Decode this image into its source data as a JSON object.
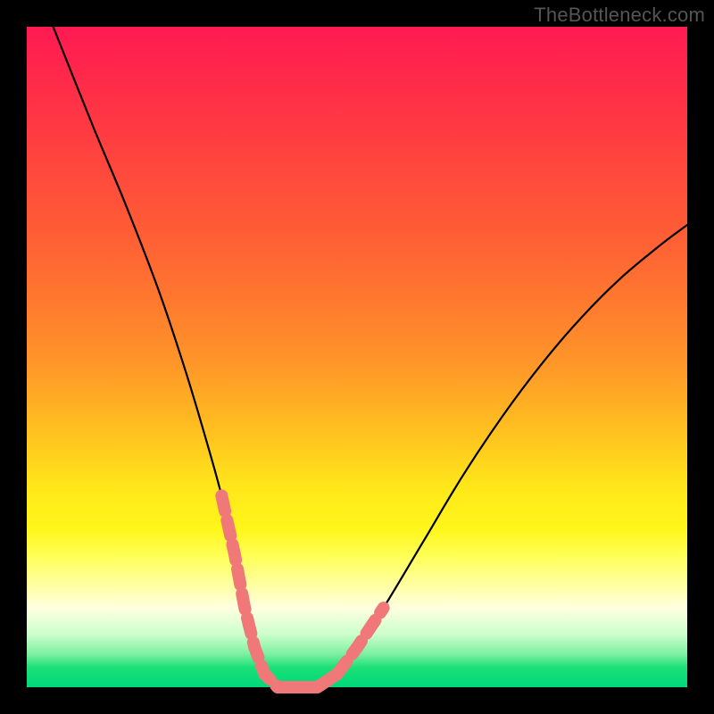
{
  "watermark": "TheBottleneck.com",
  "chart_data": {
    "type": "line",
    "title": "",
    "xlabel": "",
    "ylabel": "",
    "xlim": [
      0,
      100
    ],
    "ylim": [
      0,
      100
    ],
    "legend": false,
    "grid": false,
    "background_gradient": {
      "direction": "vertical",
      "stops": [
        {
          "pos": 0,
          "color": "#ff1a52"
        },
        {
          "pos": 30,
          "color": "#ff5a36"
        },
        {
          "pos": 62,
          "color": "#ffc41f"
        },
        {
          "pos": 80,
          "color": "#ffff55"
        },
        {
          "pos": 92,
          "color": "#ccffcc"
        },
        {
          "pos": 100,
          "color": "#00d87a"
        }
      ]
    },
    "series": [
      {
        "name": "bottleneck-curve",
        "color": "#000000",
        "x": [
          4,
          10,
          15,
          20,
          24,
          27,
          29.5,
          31.5,
          33,
          34.5,
          36,
          38,
          41,
          44,
          47,
          50,
          54,
          60,
          66,
          72,
          78,
          84,
          90,
          96,
          100
        ],
        "y": [
          100,
          85,
          73,
          60,
          48,
          38,
          29,
          20,
          12,
          6,
          2,
          0,
          0,
          0,
          2,
          6,
          12,
          22,
          32,
          41,
          49,
          56,
          62,
          67,
          70
        ]
      }
    ],
    "highlight_segments": [
      {
        "name": "left-threshold-band",
        "color": "#f07878",
        "points": [
          {
            "x": 29.5,
            "y": 29
          },
          {
            "x": 31.5,
            "y": 20
          },
          {
            "x": 33,
            "y": 12
          },
          {
            "x": 34.5,
            "y": 6
          },
          {
            "x": 36,
            "y": 2
          },
          {
            "x": 38,
            "y": 0
          }
        ]
      },
      {
        "name": "right-threshold-band",
        "color": "#f07878",
        "points": [
          {
            "x": 47,
            "y": 2
          },
          {
            "x": 50,
            "y": 6
          },
          {
            "x": 54,
            "y": 12
          }
        ]
      },
      {
        "name": "valley-floor",
        "color": "#f07878",
        "points": [
          {
            "x": 38,
            "y": 0
          },
          {
            "x": 41,
            "y": 0
          },
          {
            "x": 44,
            "y": 0
          },
          {
            "x": 47,
            "y": 2
          }
        ]
      }
    ]
  }
}
